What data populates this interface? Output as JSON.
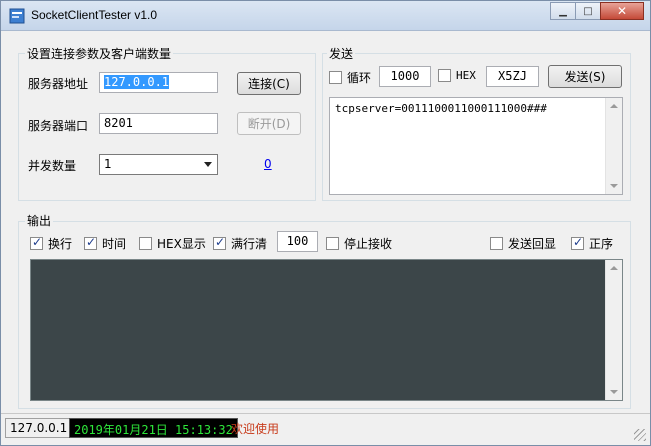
{
  "window": {
    "title": "SocketClientTester v1.0"
  },
  "connection": {
    "group_title": "设置连接参数及客户端数量",
    "server_addr_label": "服务器地址",
    "server_addr_value": "127.0.0.1",
    "connect_btn": "连接(C)",
    "server_port_label": "服务器端口",
    "server_port_value": "8201",
    "disconnect_btn": "断开(D)",
    "concurrency_label": "并发数量",
    "concurrency_value": "1",
    "count_link": "0"
  },
  "send": {
    "group_title": "发送",
    "loop_label": "循环",
    "loop_checked": false,
    "interval_value": "1000",
    "hex_label": "HEX",
    "hex_checked": false,
    "code_value": "X5ZJ",
    "send_btn": "发送(S)",
    "text": "tcpserver=0011100011000111000###"
  },
  "output": {
    "group_title": "输出",
    "wrap_label": "换行",
    "wrap_checked": true,
    "time_label": "时间",
    "time_checked": true,
    "hexshow_label": "HEX显示",
    "hexshow_checked": false,
    "fullclear_label": "满行清",
    "fullclear_checked": true,
    "lines_value": "100",
    "stop_label": "停止接收",
    "stop_checked": false,
    "echo_label": "发送回显",
    "echo_checked": false,
    "order_label": "正序",
    "order_checked": true
  },
  "status": {
    "ip": "127.0.0.1",
    "time": "2019年01月21日 15:13:32",
    "message": "欢迎使用"
  },
  "colors": {
    "output_bg": "#3c4649",
    "status_time_fg": "#2ee63a",
    "status_msg_fg": "#c83c1c"
  }
}
